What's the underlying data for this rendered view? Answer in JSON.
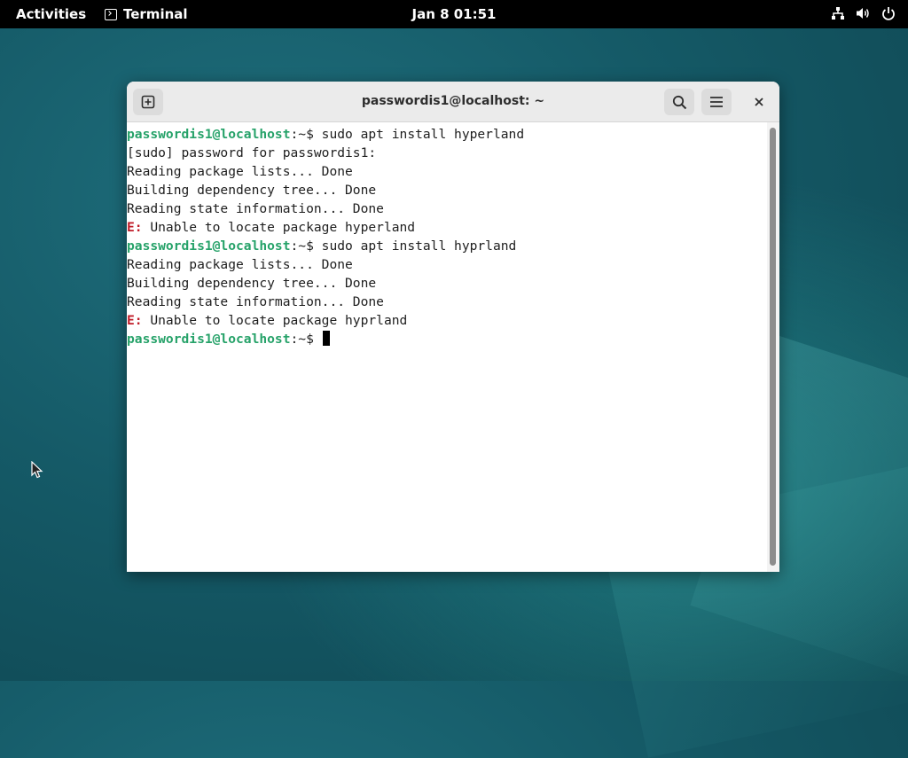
{
  "topbar": {
    "activities": "Activities",
    "app_name": "Terminal",
    "clock": "Jan 8  01:51",
    "tray_icons": [
      "network-icon",
      "volume-icon",
      "power-icon"
    ]
  },
  "window": {
    "title": "passwordis1@localhost: ~",
    "header_buttons": [
      "new-tab-icon",
      "search-icon",
      "hamburger-menu-icon",
      "close-icon"
    ]
  },
  "terminal": {
    "prompt_user": "passwordis1@localhost",
    "prompt_suffix": ":~$ ",
    "lines": [
      {
        "type": "cmd",
        "text": "sudo apt install hyperland"
      },
      {
        "type": "out",
        "text": "[sudo] password for passwordis1:"
      },
      {
        "type": "out",
        "text": "Reading package lists... Done"
      },
      {
        "type": "out",
        "text": "Building dependency tree... Done"
      },
      {
        "type": "out",
        "text": "Reading state information... Done"
      },
      {
        "type": "err",
        "label": "E:",
        "text": " Unable to locate package hyperland"
      },
      {
        "type": "cmd",
        "text": "sudo apt install hyprland"
      },
      {
        "type": "out",
        "text": "Reading package lists... Done"
      },
      {
        "type": "out",
        "text": "Building dependency tree... Done"
      },
      {
        "type": "out",
        "text": "Reading state information... Done"
      },
      {
        "type": "err",
        "label": "E:",
        "text": " Unable to locate package hyprland"
      },
      {
        "type": "prompt",
        "text": ""
      }
    ]
  },
  "colors": {
    "prompt_green": "#26a269",
    "error_red": "#c01c28",
    "topbar_bg": "#000000"
  }
}
